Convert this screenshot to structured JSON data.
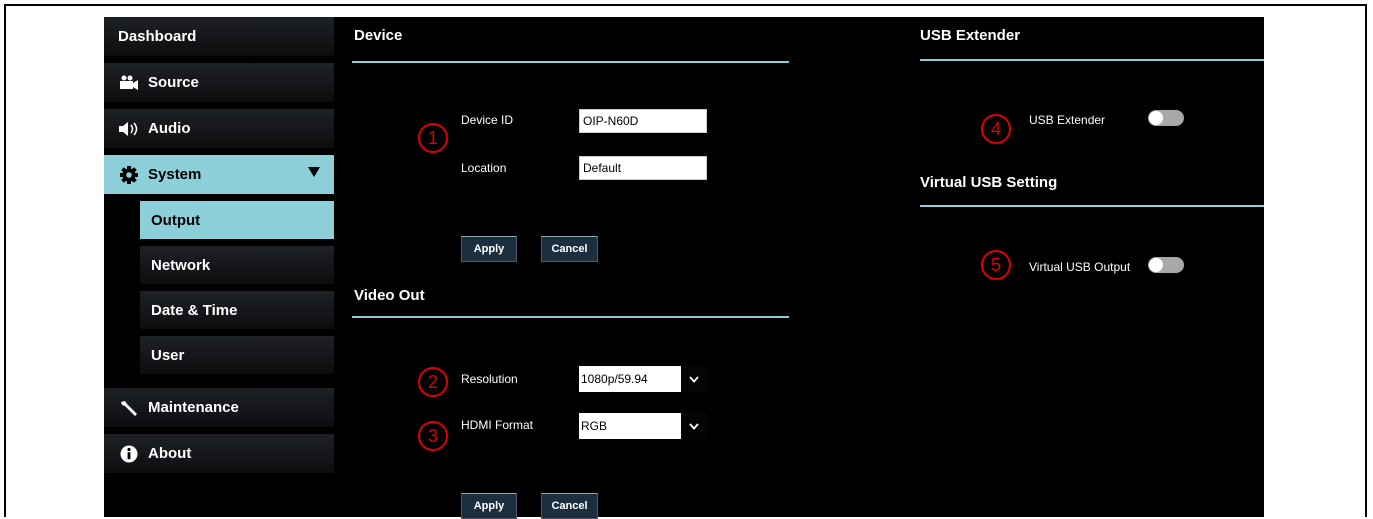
{
  "sidebar": {
    "dashboard": "Dashboard",
    "source": "Source",
    "audio": "Audio",
    "system": "System",
    "system_sub": [
      "Output",
      "Network",
      "Date & Time",
      "User"
    ],
    "maintenance": "Maintenance",
    "about": "About"
  },
  "device": {
    "title": "Device",
    "device_id_label": "Device ID",
    "device_id_value": "OIP-N60D",
    "location_label": "Location",
    "location_value": "Default",
    "apply": "Apply",
    "cancel": "Cancel"
  },
  "video_out": {
    "title": "Video Out",
    "resolution_label": "Resolution",
    "resolution_value": "1080p/59.94",
    "hdmi_format_label": "HDMI Format",
    "hdmi_format_value": "RGB",
    "apply": "Apply",
    "cancel": "Cancel"
  },
  "usb_extender": {
    "title": "USB Extender",
    "label": "USB Extender",
    "enabled": false
  },
  "virtual_usb": {
    "title": "Virtual USB Setting",
    "label": "Virtual USB Output",
    "enabled": false
  },
  "callouts": [
    "1",
    "2",
    "3",
    "4",
    "5"
  ],
  "colors": {
    "accent": "#8ccfd9",
    "callout": "#e00000",
    "background": "#000000"
  },
  "icons": {
    "source": "video-camera-icon",
    "audio": "speaker-icon",
    "system": "gear-icon",
    "maintenance": "wrench-icon",
    "about": "info-icon",
    "select": "chevron-down-icon"
  }
}
